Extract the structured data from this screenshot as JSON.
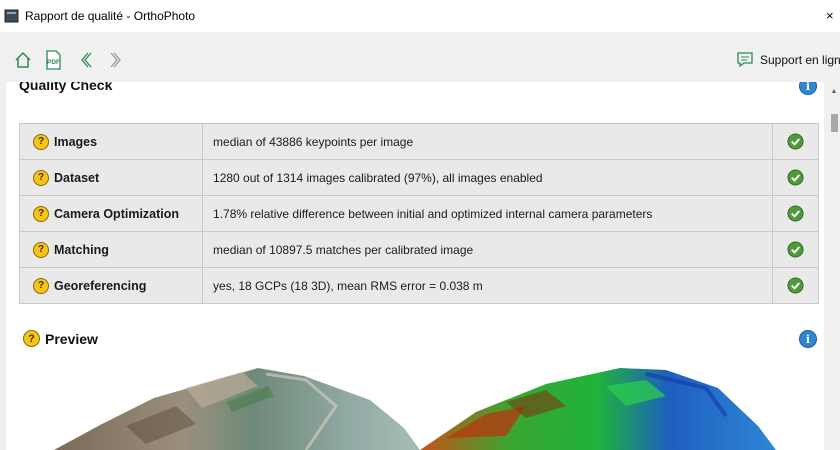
{
  "window": {
    "title": "Rapport de qualité - OrthoPhoto",
    "close_glyph": "×"
  },
  "toolbar": {
    "buttons": [
      {
        "icon": "home-icon"
      },
      {
        "icon": "pdf-icon",
        "label": "PDF"
      },
      {
        "icon": "back-icon"
      },
      {
        "icon": "forward-icon"
      }
    ],
    "support_label": "Support en ligne",
    "support_icon": "chat-icon"
  },
  "quality_check": {
    "title": "Quality Check",
    "help_glyph": "?",
    "info_glyph": "i",
    "rows": [
      {
        "name": "Images",
        "value": "median of 43886 keypoints per image",
        "status": "ok"
      },
      {
        "name": "Dataset",
        "value": "1280 out of 1314 images calibrated (97%), all images enabled",
        "status": "ok"
      },
      {
        "name": "Camera Optimization",
        "value": "1.78% relative difference between initial and optimized internal camera parameters",
        "status": "ok"
      },
      {
        "name": "Matching",
        "value": "median of 10897.5 matches per calibrated image",
        "status": "ok"
      },
      {
        "name": "Georeferencing",
        "value": "yes, 18 GCPs (18 3D), mean RMS error = 0.038 m",
        "status": "ok"
      }
    ]
  },
  "preview": {
    "title": "Preview",
    "help_glyph": "?",
    "info_glyph": "i"
  },
  "colors": {
    "ok_green": "#4f9a3a",
    "help_yellow": "#f5c518",
    "info_blue": "#2f86d0"
  }
}
